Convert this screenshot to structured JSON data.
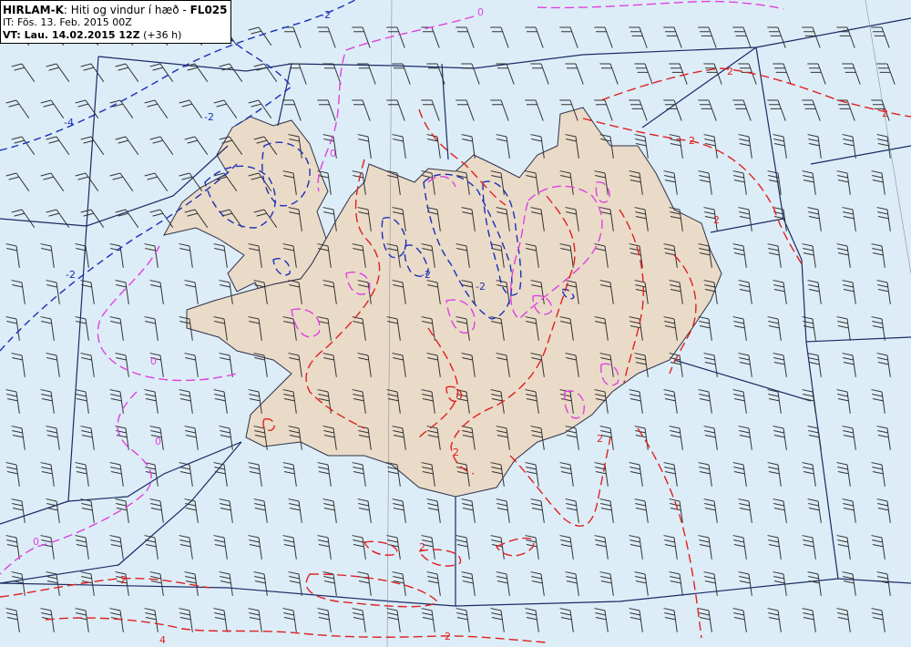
{
  "legend": {
    "model": "HIRLAM-K",
    "description": ": Hiti og vindur í hæð - ",
    "level": "FL025",
    "it_label": "IT: Fös. 13. Feb. 2015 00Z",
    "vt_label": "VT: Lau. 14.02.2015 12Z",
    "vt_extra": " (+36 h)"
  },
  "colors": {
    "sea": "#dcedf7",
    "land": "#eadbc8",
    "coast": "#30304a",
    "district_lines": "#1a2a66",
    "contour_minus4": "#1a2fb8",
    "contour_minus2": "#1a2fb8",
    "contour_0": "#e040e0",
    "contour_plus2": "#e02020",
    "contour_plus4": "#e02020",
    "wind_barbs": "#333333"
  },
  "contour_labels": [
    "-4",
    "-2",
    "-2",
    "-2",
    "-2",
    "-2",
    "0",
    "0",
    "0",
    "0",
    "0",
    "2",
    "2",
    "2",
    "2",
    "2",
    "2",
    "2",
    "2",
    "2",
    "4"
  ],
  "wind_barb_icon": "wind-barb-icon"
}
